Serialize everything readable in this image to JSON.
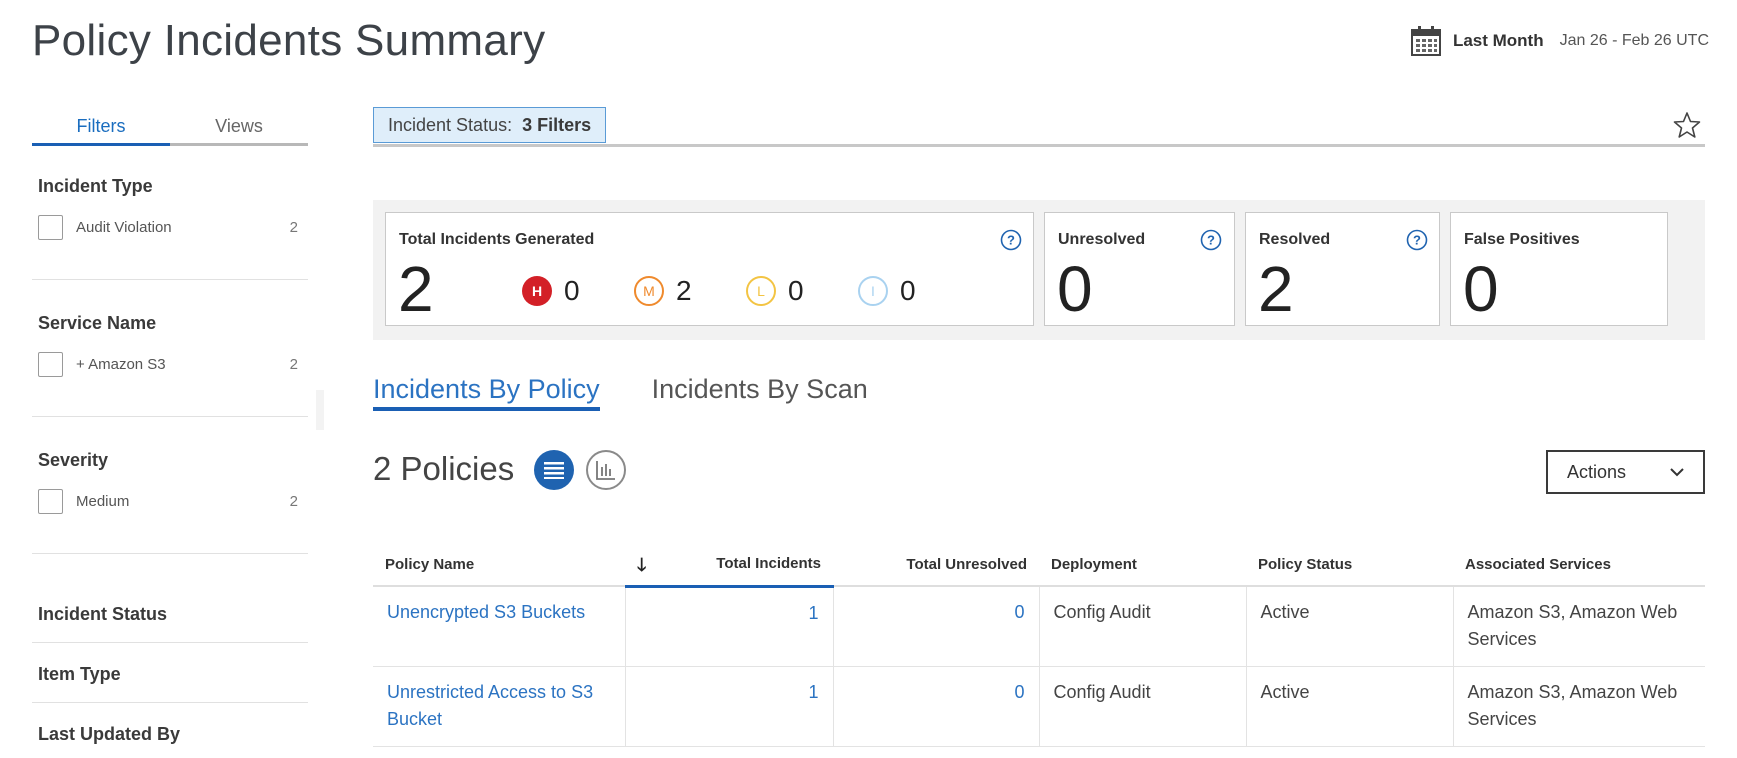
{
  "header": {
    "title": "Policy Incidents Summary",
    "date_label": "Last Month",
    "date_range": "Jan 26 - Feb 26 UTC"
  },
  "sidebar": {
    "tabs": [
      {
        "label": "Filters",
        "active": true
      },
      {
        "label": "Views",
        "active": false
      }
    ],
    "groups": [
      {
        "title": "Incident Type",
        "items": [
          {
            "label": "Audit Violation",
            "count": "2"
          }
        ]
      },
      {
        "title": "Service Name",
        "items": [
          {
            "label": "+ Amazon S3",
            "count": "2"
          }
        ]
      },
      {
        "title": "Severity",
        "items": [
          {
            "label": "Medium",
            "count": "2"
          }
        ]
      },
      {
        "title": "Incident Status"
      },
      {
        "title": "Item Type"
      },
      {
        "title": "Last Updated By"
      }
    ]
  },
  "filter_bar": {
    "label": "Incident Status:",
    "value": "3 Filters"
  },
  "summary": {
    "total": {
      "title": "Total Incidents Generated",
      "value": "2"
    },
    "severity": [
      {
        "letter": "H",
        "count": "0",
        "color": "#d32027"
      },
      {
        "letter": "M",
        "count": "2",
        "color": "#ef8a2d"
      },
      {
        "letter": "L",
        "count": "0",
        "color": "#f3c443"
      },
      {
        "letter": "I",
        "count": "0",
        "color": "#a9d2f0"
      }
    ],
    "unresolved": {
      "title": "Unresolved",
      "value": "0"
    },
    "resolved": {
      "title": "Resolved",
      "value": "2"
    },
    "false_positives": {
      "title": "False Positives",
      "value": "0"
    }
  },
  "content_tabs": [
    {
      "label": "Incidents By Policy",
      "active": true
    },
    {
      "label": "Incidents By Scan",
      "active": false
    }
  ],
  "policies_count": "2 Policies",
  "actions_label": "Actions",
  "table": {
    "columns": [
      "Policy Name",
      "Total Incidents",
      "Total Unresolved",
      "Deployment",
      "Policy Status",
      "Associated Services"
    ],
    "rows": [
      {
        "name": "Unencrypted S3 Buckets",
        "total": "1",
        "unresolved": "0",
        "deployment": "Config Audit",
        "status": "Active",
        "services": "Amazon S3, Amazon Web Services"
      },
      {
        "name": "Unrestricted Access to S3 Bucket",
        "total": "1",
        "unresolved": "0",
        "deployment": "Config Audit",
        "status": "Active",
        "services": "Amazon S3, Amazon Web Services"
      }
    ]
  },
  "colors": {
    "accent": "#1a5fb4",
    "link": "#2b73c2",
    "chip_bg": "#dfeefa"
  }
}
